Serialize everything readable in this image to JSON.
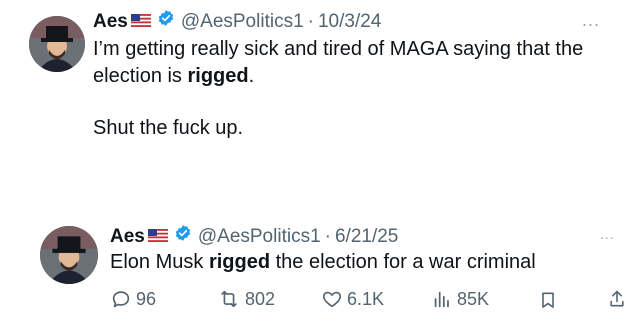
{
  "tweets": [
    {
      "author": {
        "name": "Aes",
        "handle": "@AesPolitics1",
        "verified": true,
        "flag": "us-flag-icon"
      },
      "date": "10/3/24",
      "dot": "·",
      "more": "...",
      "lines": [
        {
          "parts": [
            "I’m getting really sick and tired of MAGA saying that the"
          ]
        },
        {
          "parts": [
            "election is ",
            "rigged",
            "."
          ]
        },
        {
          "parts": [
            "Shut the fuck up."
          ]
        }
      ]
    },
    {
      "author": {
        "name": "Aes",
        "handle": "@AesPolitics1",
        "verified": true,
        "flag": "us-flag-icon"
      },
      "date": "6/21/25",
      "dot": "·",
      "more": "...",
      "lines": [
        {
          "parts": [
            "Elon Musk ",
            "rigged",
            " the election for a war criminal"
          ]
        }
      ],
      "actions": {
        "replies": "96",
        "reposts": "802",
        "likes": "6.1K",
        "views": "85K"
      }
    }
  ],
  "colors": {
    "text": "#0f1419",
    "muted": "#536471",
    "verified": "#1d9bf0"
  }
}
